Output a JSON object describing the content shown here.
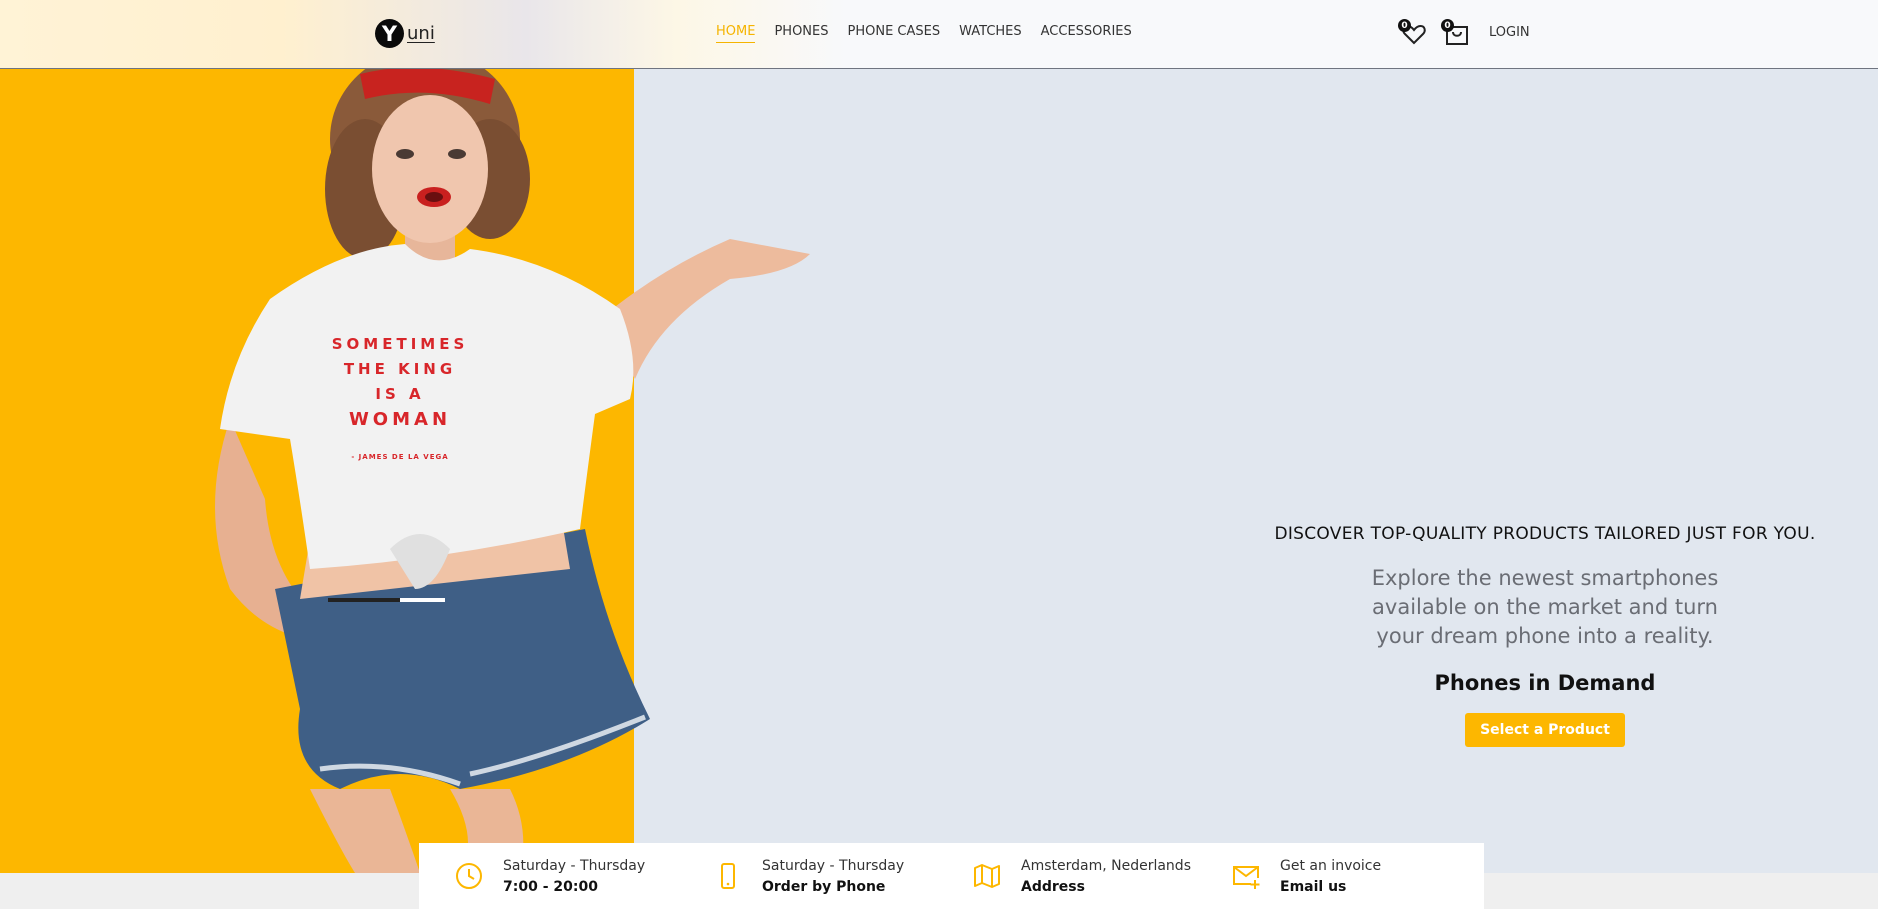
{
  "brand": {
    "logo_letter": "Y",
    "logo_text": "uni"
  },
  "nav": {
    "items": [
      {
        "label": "HOME",
        "active": true
      },
      {
        "label": "PHONES"
      },
      {
        "label": "PHONE CASES"
      },
      {
        "label": "WATCHES"
      },
      {
        "label": "ACCESSORIES"
      }
    ],
    "wishlist_count": "0",
    "cart_count": "0",
    "login_label": "LOGIN"
  },
  "hero": {
    "tshirt_lines": [
      "SOMETIMES",
      "THE KING",
      "IS A",
      "WOMAN",
      "- JAMES DE LA VEGA"
    ],
    "kicker": "DISCOVER TOP-QUALITY PRODUCTS TAILORED JUST FOR YOU.",
    "description": "Explore the newest smartphones available on the market and turn your dream phone into a reality.",
    "title": "Phones in Demand",
    "button_label": "Select a Product"
  },
  "info_bar": [
    {
      "icon": "clock-icon",
      "line1": "Saturday - Thursday",
      "line2": "7:00 - 20:00"
    },
    {
      "icon": "phone-icon",
      "line1": "Saturday - Thursday",
      "line2": "Order by Phone"
    },
    {
      "icon": "map-icon",
      "line1": "Amsterdam, Nederlands",
      "line2": "Address"
    },
    {
      "icon": "mail-plus-icon",
      "line1": "Get an invoice",
      "line2": "Email us"
    }
  ],
  "colors": {
    "accent": "#fdb700",
    "hero_bg": "#e1e7ef"
  }
}
